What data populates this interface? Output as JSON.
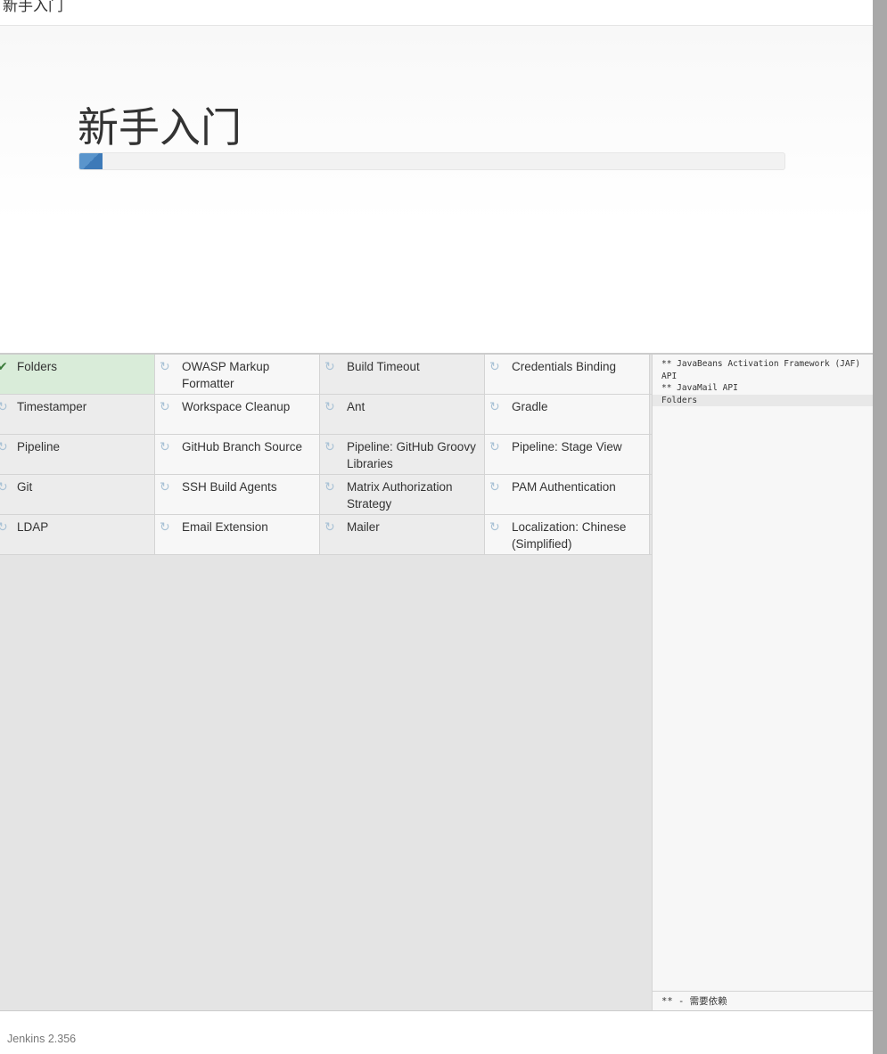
{
  "window_title": "新手入门",
  "hero": {
    "title": "新手入门",
    "progress_percent": 3.3
  },
  "plugins": [
    [
      {
        "name": "Folders",
        "status": "done"
      },
      {
        "name": "OWASP Markup Formatter",
        "status": "pending"
      },
      {
        "name": "Build Timeout",
        "status": "pending"
      },
      {
        "name": "Credentials Binding",
        "status": "pending"
      }
    ],
    [
      {
        "name": "Timestamper",
        "status": "pending"
      },
      {
        "name": "Workspace Cleanup",
        "status": "pending"
      },
      {
        "name": "Ant",
        "status": "pending"
      },
      {
        "name": "Gradle",
        "status": "pending"
      }
    ],
    [
      {
        "name": "Pipeline",
        "status": "pending"
      },
      {
        "name": "GitHub Branch Source",
        "status": "pending"
      },
      {
        "name": "Pipeline: GitHub Groovy Libraries",
        "status": "pending"
      },
      {
        "name": "Pipeline: Stage View",
        "status": "pending"
      }
    ],
    [
      {
        "name": "Git",
        "status": "pending"
      },
      {
        "name": "SSH Build Agents",
        "status": "pending"
      },
      {
        "name": "Matrix Authorization Strategy",
        "status": "pending"
      },
      {
        "name": "PAM Authentication",
        "status": "pending"
      }
    ],
    [
      {
        "name": "LDAP",
        "status": "pending"
      },
      {
        "name": "Email Extension",
        "status": "pending"
      },
      {
        "name": "Mailer",
        "status": "pending"
      },
      {
        "name": "Localization: Chinese (Simplified)",
        "status": "pending"
      }
    ]
  ],
  "log": {
    "lines": [
      "** JavaBeans Activation Framework (JAF) API",
      "** JavaMail API",
      "Folders"
    ],
    "footer": "** - 需要依赖"
  },
  "footer": {
    "version": "Jenkins 2.356"
  },
  "icons": {
    "done": "check-icon",
    "pending": "refresh-icon"
  }
}
